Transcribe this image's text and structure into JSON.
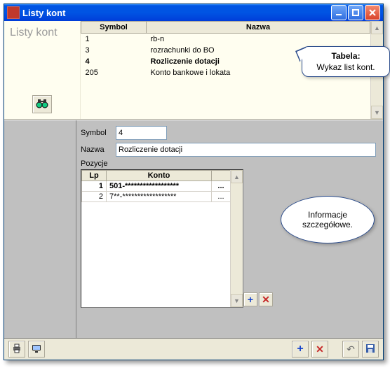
{
  "window": {
    "title": "Listy kont"
  },
  "leftPane": {
    "title": "Listy kont"
  },
  "topTable": {
    "headers": {
      "symbol": "Symbol",
      "nazwa": "Nazwa"
    },
    "rows": [
      {
        "symbol": "1",
        "nazwa": "rb-n",
        "selected": false
      },
      {
        "symbol": "3",
        "nazwa": "rozrachunki do BO",
        "selected": false
      },
      {
        "symbol": "4",
        "nazwa": "Rozliczenie dotacji",
        "selected": true
      },
      {
        "symbol": "205",
        "nazwa": "Konto bankowe i lokata",
        "selected": false
      }
    ]
  },
  "detail": {
    "labels": {
      "symbol": "Symbol",
      "nazwa": "Nazwa",
      "pozycje": "Pozycje"
    },
    "symbol": "4",
    "nazwa": "Rozliczenie dotacji"
  },
  "subTable": {
    "headers": {
      "lp": "Lp",
      "konto": "Konto"
    },
    "rows": [
      {
        "lp": "1",
        "konto": "501-******************",
        "bold": true
      },
      {
        "lp": "2",
        "konto": "7**-******************",
        "bold": false
      }
    ],
    "rowButtonLabel": "..."
  },
  "callouts": {
    "c1": {
      "title": "Tabela:",
      "text": "Wykaz list kont."
    },
    "c2": {
      "text": "Informacje szczegółowe."
    }
  }
}
